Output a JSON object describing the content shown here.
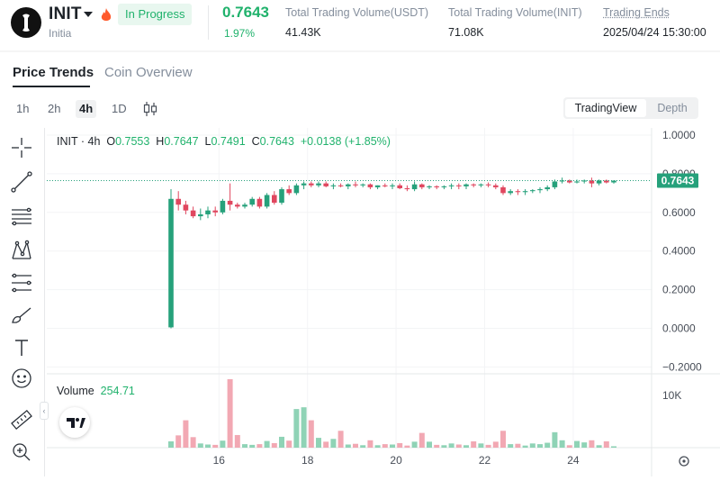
{
  "header": {
    "symbol": "INIT",
    "full_name": "Initia",
    "status_badge": "In Progress",
    "price": "0.7643",
    "change_pct": "1.97%",
    "stats": [
      {
        "label": "Total Trading Volume(USDT)",
        "value": "41.43K"
      },
      {
        "label": "Total Trading Volume(INIT)",
        "value": "71.08K"
      },
      {
        "label": "Trading Ends",
        "value": "2025/04/24 15:30:00"
      }
    ]
  },
  "tabs": [
    "Price Trends",
    "Coin Overview"
  ],
  "timeframes": [
    "1h",
    "2h",
    "4h",
    "1D"
  ],
  "active_timeframe": "4h",
  "view_toggle": {
    "active": "TradingView",
    "inactive": "Depth"
  },
  "tools": [
    "crosshair-icon",
    "trendline-icon",
    "fib-retracement-icon",
    "pattern-icon",
    "prediction-icon",
    "brush-icon",
    "text-icon",
    "emoji-icon",
    "ruler-icon",
    "zoom-in-icon"
  ],
  "legend": {
    "symbol_tf": "INIT · 4h",
    "o_label": "O",
    "o": "0.7553",
    "h_label": "H",
    "h": "0.7647",
    "l_label": "L",
    "l": "0.7491",
    "c_label": "C",
    "c": "0.7643",
    "change": "+0.0138 (+1.85%)"
  },
  "volume_legend": {
    "label": "Volume",
    "value": "254.71"
  },
  "colors": {
    "up": "#26a17b",
    "down": "#e0475f",
    "vol_up": "#8fd3b6",
    "vol_down": "#f2a8b3",
    "accent": "#20b26c"
  },
  "chart_data": {
    "type": "candlestick",
    "price_axis_ticks": [
      "1.0000",
      "0.8000",
      "0.6000",
      "0.4000",
      "0.2000",
      "0.0000",
      "−0.2000"
    ],
    "ylim": [
      -0.2,
      1.0
    ],
    "last_price_label": "0.7643",
    "volume_axis_tick": "10K",
    "x_ticks": [
      "16",
      "18",
      "20",
      "22",
      "24"
    ],
    "candles": [
      {
        "o": 0.005,
        "h": 0.72,
        "l": 0.0,
        "c": 0.67,
        "v": 1800
      },
      {
        "o": 0.67,
        "h": 0.71,
        "l": 0.61,
        "c": 0.64,
        "v": 3500
      },
      {
        "o": 0.64,
        "h": 0.66,
        "l": 0.59,
        "c": 0.61,
        "v": 7800
      },
      {
        "o": 0.61,
        "h": 0.63,
        "l": 0.57,
        "c": 0.58,
        "v": 3000
      },
      {
        "o": 0.58,
        "h": 0.62,
        "l": 0.56,
        "c": 0.59,
        "v": 1200
      },
      {
        "o": 0.59,
        "h": 0.63,
        "l": 0.57,
        "c": 0.61,
        "v": 900
      },
      {
        "o": 0.61,
        "h": 0.63,
        "l": 0.58,
        "c": 0.6,
        "v": 800
      },
      {
        "o": 0.6,
        "h": 0.67,
        "l": 0.59,
        "c": 0.66,
        "v": 2000
      },
      {
        "o": 0.66,
        "h": 0.75,
        "l": 0.61,
        "c": 0.64,
        "v": 19500
      },
      {
        "o": 0.64,
        "h": 0.65,
        "l": 0.62,
        "c": 0.63,
        "v": 3600
      },
      {
        "o": 0.63,
        "h": 0.65,
        "l": 0.62,
        "c": 0.64,
        "v": 1000
      },
      {
        "o": 0.64,
        "h": 0.68,
        "l": 0.63,
        "c": 0.67,
        "v": 800
      },
      {
        "o": 0.67,
        "h": 0.68,
        "l": 0.62,
        "c": 0.63,
        "v": 1000
      },
      {
        "o": 0.63,
        "h": 0.7,
        "l": 0.62,
        "c": 0.69,
        "v": 1900
      },
      {
        "o": 0.69,
        "h": 0.71,
        "l": 0.64,
        "c": 0.65,
        "v": 1300
      },
      {
        "o": 0.65,
        "h": 0.73,
        "l": 0.64,
        "c": 0.72,
        "v": 3100
      },
      {
        "o": 0.72,
        "h": 0.74,
        "l": 0.69,
        "c": 0.7,
        "v": 2000
      },
      {
        "o": 0.7,
        "h": 0.75,
        "l": 0.69,
        "c": 0.74,
        "v": 11000
      },
      {
        "o": 0.74,
        "h": 0.76,
        "l": 0.72,
        "c": 0.75,
        "v": 11500
      },
      {
        "o": 0.75,
        "h": 0.76,
        "l": 0.73,
        "c": 0.74,
        "v": 7800
      },
      {
        "o": 0.74,
        "h": 0.76,
        "l": 0.73,
        "c": 0.75,
        "v": 2800
      },
      {
        "o": 0.75,
        "h": 0.76,
        "l": 0.73,
        "c": 0.735,
        "v": 1700
      },
      {
        "o": 0.735,
        "h": 0.75,
        "l": 0.72,
        "c": 0.74,
        "v": 2500
      },
      {
        "o": 0.74,
        "h": 0.75,
        "l": 0.73,
        "c": 0.735,
        "v": 4800
      },
      {
        "o": 0.735,
        "h": 0.75,
        "l": 0.72,
        "c": 0.745,
        "v": 900
      },
      {
        "o": 0.745,
        "h": 0.76,
        "l": 0.73,
        "c": 0.74,
        "v": 1100
      },
      {
        "o": 0.74,
        "h": 0.75,
        "l": 0.73,
        "c": 0.745,
        "v": 700
      },
      {
        "o": 0.745,
        "h": 0.75,
        "l": 0.72,
        "c": 0.73,
        "v": 2100
      },
      {
        "o": 0.73,
        "h": 0.74,
        "l": 0.72,
        "c": 0.74,
        "v": 700
      },
      {
        "o": 0.74,
        "h": 0.75,
        "l": 0.73,
        "c": 0.735,
        "v": 1000
      },
      {
        "o": 0.735,
        "h": 0.75,
        "l": 0.72,
        "c": 0.74,
        "v": 900
      },
      {
        "o": 0.74,
        "h": 0.75,
        "l": 0.72,
        "c": 0.725,
        "v": 1300
      },
      {
        "o": 0.725,
        "h": 0.74,
        "l": 0.71,
        "c": 0.72,
        "v": 600
      },
      {
        "o": 0.72,
        "h": 0.76,
        "l": 0.71,
        "c": 0.745,
        "v": 1700
      },
      {
        "o": 0.745,
        "h": 0.75,
        "l": 0.72,
        "c": 0.73,
        "v": 4200
      },
      {
        "o": 0.73,
        "h": 0.74,
        "l": 0.72,
        "c": 0.735,
        "v": 1700
      },
      {
        "o": 0.735,
        "h": 0.74,
        "l": 0.72,
        "c": 0.73,
        "v": 800
      },
      {
        "o": 0.73,
        "h": 0.74,
        "l": 0.72,
        "c": 0.735,
        "v": 700
      },
      {
        "o": 0.735,
        "h": 0.75,
        "l": 0.72,
        "c": 0.74,
        "v": 1200
      },
      {
        "o": 0.74,
        "h": 0.75,
        "l": 0.72,
        "c": 0.735,
        "v": 900
      },
      {
        "o": 0.735,
        "h": 0.75,
        "l": 0.72,
        "c": 0.745,
        "v": 700
      },
      {
        "o": 0.745,
        "h": 0.75,
        "l": 0.73,
        "c": 0.74,
        "v": 1800
      },
      {
        "o": 0.74,
        "h": 0.75,
        "l": 0.73,
        "c": 0.745,
        "v": 1200
      },
      {
        "o": 0.745,
        "h": 0.755,
        "l": 0.73,
        "c": 0.74,
        "v": 800
      },
      {
        "o": 0.74,
        "h": 0.75,
        "l": 0.72,
        "c": 0.73,
        "v": 1700
      },
      {
        "o": 0.73,
        "h": 0.74,
        "l": 0.69,
        "c": 0.7,
        "v": 4800
      },
      {
        "o": 0.7,
        "h": 0.72,
        "l": 0.69,
        "c": 0.71,
        "v": 1000
      },
      {
        "o": 0.71,
        "h": 0.72,
        "l": 0.69,
        "c": 0.705,
        "v": 1100
      },
      {
        "o": 0.705,
        "h": 0.72,
        "l": 0.69,
        "c": 0.71,
        "v": 600
      },
      {
        "o": 0.71,
        "h": 0.72,
        "l": 0.7,
        "c": 0.715,
        "v": 1200
      },
      {
        "o": 0.715,
        "h": 0.73,
        "l": 0.7,
        "c": 0.72,
        "v": 1000
      },
      {
        "o": 0.72,
        "h": 0.74,
        "l": 0.71,
        "c": 0.73,
        "v": 1400
      },
      {
        "o": 0.73,
        "h": 0.77,
        "l": 0.72,
        "c": 0.76,
        "v": 4400
      },
      {
        "o": 0.76,
        "h": 0.78,
        "l": 0.75,
        "c": 0.765,
        "v": 2100
      },
      {
        "o": 0.765,
        "h": 0.77,
        "l": 0.75,
        "c": 0.755,
        "v": 700
      },
      {
        "o": 0.755,
        "h": 0.77,
        "l": 0.75,
        "c": 0.76,
        "v": 1900
      },
      {
        "o": 0.76,
        "h": 0.77,
        "l": 0.75,
        "c": 0.765,
        "v": 1500
      },
      {
        "o": 0.765,
        "h": 0.78,
        "l": 0.73,
        "c": 0.75,
        "v": 2100
      },
      {
        "o": 0.75,
        "h": 0.77,
        "l": 0.74,
        "c": 0.765,
        "v": 700
      },
      {
        "o": 0.765,
        "h": 0.77,
        "l": 0.75,
        "c": 0.755,
        "v": 1800
      },
      {
        "o": 0.755,
        "h": 0.766,
        "l": 0.749,
        "c": 0.7643,
        "v": 400
      }
    ]
  }
}
